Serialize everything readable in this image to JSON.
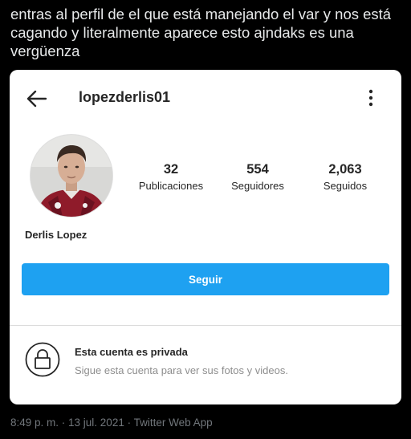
{
  "tweet": {
    "text": "entras al perfil de el que está manejando el var y nos está cagando y literalmente aparece esto ajndaks es una vergüenza",
    "meta": "8:49 p. m. · 13 jul. 2021 · Twitter Web App"
  },
  "profile": {
    "username": "lopezderlis01",
    "display_name": "Derlis Lopez",
    "stats": [
      {
        "value": "32",
        "label": "Publicaciones"
      },
      {
        "value": "554",
        "label": "Seguidores"
      },
      {
        "value": "2,063",
        "label": "Seguidos"
      }
    ],
    "follow_label": "Seguir",
    "private_title": "Esta cuenta es privada",
    "private_subtitle": "Sigue esta cuenta para ver sus fotos y videos."
  },
  "icons": {
    "back": "back-arrow-icon",
    "more": "more-vertical-icon",
    "lock": "lock-icon",
    "avatar": "avatar-photo"
  },
  "colors": {
    "background": "#000000",
    "card": "#ffffff",
    "follow_button": "#1ea1f1",
    "tweet_text": "#e7e9ea",
    "meta_text": "#71767b",
    "secondary_text": "#8e8e8e"
  }
}
